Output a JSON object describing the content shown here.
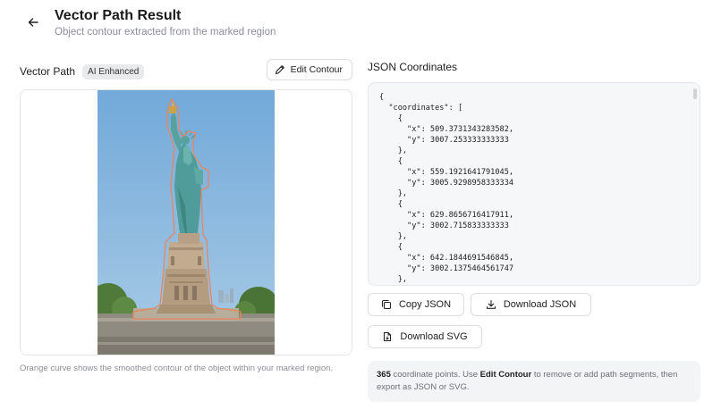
{
  "header": {
    "title": "Vector Path Result",
    "subtitle": "Object contour extracted from the marked region"
  },
  "left": {
    "title": "Vector Path",
    "badge": "AI Enhanced",
    "edit_label": "Edit Contour",
    "caption": "Orange curve shows the smoothed contour of the object within your marked region."
  },
  "right": {
    "title": "JSON Coordinates",
    "json_text": "{\n  \"coordinates\": [\n    {\n      \"x\": 509.3731343283582,\n      \"y\": 3007.253333333333\n    },\n    {\n      \"x\": 559.1921641791045,\n      \"y\": 3005.9298958333334\n    },\n    {\n      \"x\": 629.8656716417911,\n      \"y\": 3002.715833333333\n    },\n    {\n      \"x\": 642.1844691546845,\n      \"y\": 3002.1375464561747\n    },"
  },
  "actions": {
    "copy_json": "Copy JSON",
    "download_json": "Download JSON",
    "download_svg": "Download SVG"
  },
  "info": {
    "count": "365",
    "text1": " coordinate points. Use ",
    "edit_ref": "Edit Contour",
    "text2": " to remove or add path segments, then export as JSON or SVG."
  },
  "colors": {
    "contour": "#e8855f",
    "sky": "#7fb2dc",
    "statue": "#4f9c9a"
  },
  "icons": {
    "back": "arrow-left-icon",
    "edit": "pencil-icon",
    "copy": "copy-icon",
    "download": "download-icon",
    "svg_file": "file-icon"
  }
}
